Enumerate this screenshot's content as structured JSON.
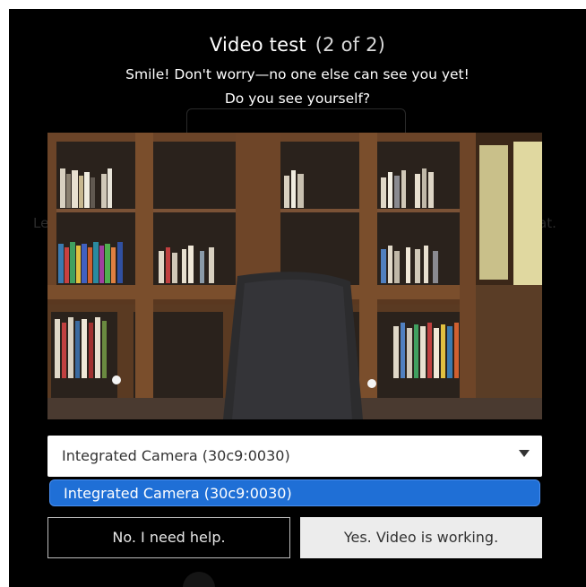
{
  "dialog": {
    "title": "Video test",
    "step": "(2 of 2)",
    "line1": "Smile! Don't worry—no one else can see you yet!",
    "line2": "Do you see yourself?"
  },
  "camera_select": {
    "selected": "Integrated Camera (30c9:0030)",
    "options": [
      "Integrated Camera (30c9:0030)"
    ]
  },
  "buttons": {
    "no": "No. I need help.",
    "yes": "Yes. Video is working."
  },
  "colors": {
    "highlight": "#1f6fd6",
    "background": "#000000"
  }
}
